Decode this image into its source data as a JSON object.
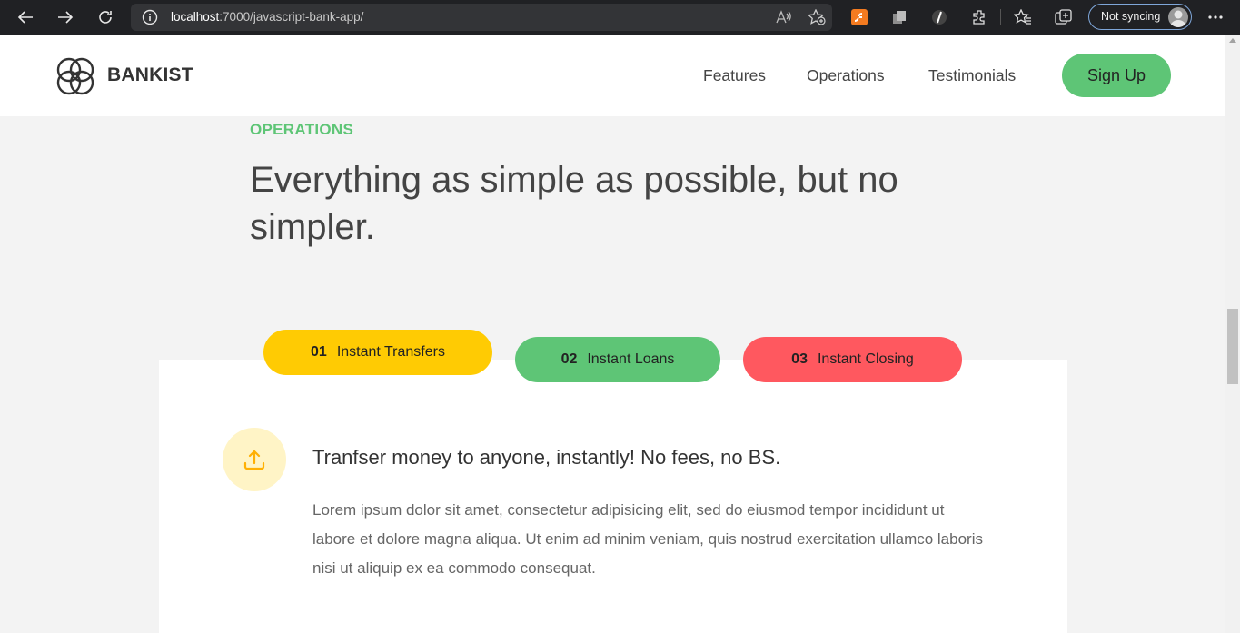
{
  "browser": {
    "url_host": "localhost",
    "url_path": ":7000/javascript-bank-app/",
    "sync_label": "Not syncing",
    "icons": [
      "back-icon",
      "forward-icon",
      "refresh-icon",
      "info-icon",
      "read-aloud-icon",
      "add-favorite-icon",
      "extension-icon",
      "collections-icon",
      "more-icon"
    ]
  },
  "header": {
    "brand": "BANKIST",
    "nav": [
      "Features",
      "Operations",
      "Testimonials"
    ],
    "cta": "Sign Up"
  },
  "section": {
    "label": "OPERATIONS",
    "title": "Everything as simple as possible, but no simpler."
  },
  "tabs": [
    {
      "num": "01",
      "label": "Instant Transfers",
      "color": "#ffcb03"
    },
    {
      "num": "02",
      "label": "Instant Loans",
      "color": "#5ec576"
    },
    {
      "num": "03",
      "label": "Instant Closing",
      "color": "#ff585f"
    }
  ],
  "content": {
    "heading": "Tranfser money to anyone, instantly! No fees, no BS.",
    "body": "Lorem ipsum dolor sit amet, consectetur adipisicing elit, sed do eiusmod tempor incididunt ut labore et dolore magna aliqua. Ut enim ad minim veniam, quis nostrud exercitation ullamco laboris nisi ut aliquip ex ea commodo consequat.",
    "icon": "upload-icon"
  }
}
